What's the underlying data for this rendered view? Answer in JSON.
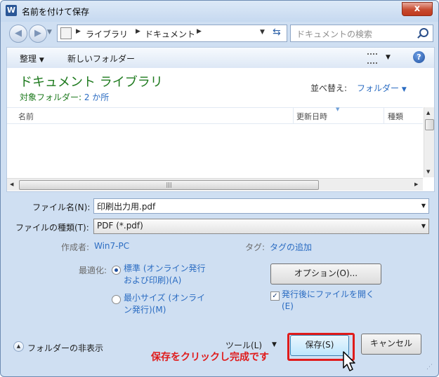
{
  "window": {
    "app_icon": "W",
    "title": "名前を付けて保存",
    "close_glyph": "x"
  },
  "address": {
    "segments": [
      "ライブラリ",
      "ドキュメント"
    ],
    "search_placeholder": "ドキュメントの検索"
  },
  "toolbar": {
    "organize_label": "整理",
    "new_folder_label": "新しいフォルダー",
    "help_glyph": "?"
  },
  "library": {
    "title": "ドキュメント ライブラリ",
    "subtitle_prefix": "対象フォルダー: ",
    "subtitle_link": "2 か所",
    "arrange_label": "並べ替え:",
    "arrange_value": "フォルダー"
  },
  "columns": [
    "名前",
    "更新日時",
    "種類"
  ],
  "form": {
    "filename_label": "ファイル名(N):",
    "filename_value": "印刷出力用.pdf",
    "filetype_label": "ファイルの種類(T):",
    "filetype_value": "PDF (*.pdf)",
    "author_label": "作成者:",
    "author_value": "Win7-PC",
    "tags_label": "タグ:",
    "tags_value": "タグの追加"
  },
  "optimize": {
    "label": "最適化:",
    "option1": "標準 (オンライン発行および印刷)(A)",
    "option1_line1": "標準 (オンライン発行",
    "option1_line2": "および印刷)(A)",
    "option2": "最小サイズ (オンライン発行)(M)",
    "option2_line1": "最小サイズ (オンライ",
    "option2_line2": "ン発行)(M)",
    "selected": "option1"
  },
  "options_button": "オプション(O)...",
  "open_after_publish": {
    "line1": "発行後にファイルを開く",
    "line2": "(E)",
    "checked": true
  },
  "footer": {
    "hide_folders": "フォルダーの非表示",
    "tools": "ツール(L)",
    "save": "保存(S)",
    "cancel": "キャンセル"
  },
  "annotation": "保存をクリックし完成です",
  "colors": {
    "accent_red": "#e01b1b",
    "library_green": "#1e7a1e",
    "link_blue": "#2b6cc2"
  }
}
